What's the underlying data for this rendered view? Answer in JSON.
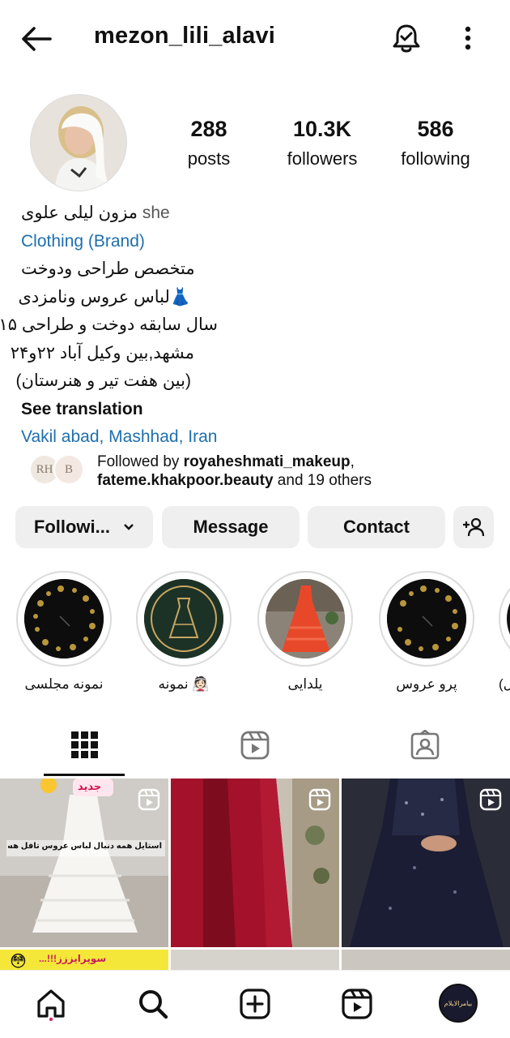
{
  "header": {
    "username": "mezon_lili_alavi",
    "back_icon": "arrow-left-icon",
    "bell_icon": "bell-icon",
    "more_icon": "more-vertical-icon"
  },
  "stats": {
    "posts_count": "288",
    "posts_label": "posts",
    "followers_count": "10.3K",
    "followers_label": "followers",
    "following_count": "586",
    "following_label": "following"
  },
  "bio": {
    "pronoun": "she",
    "name": "مزون لیلی علوی",
    "category": "Clothing (Brand)",
    "lines": [
      "متخصص طراحی ودوخت",
      "👗لباس عروس ونامزدی",
      "سال سابقه دوخت و طراحی ۱۵",
      "مشهد,بین وکیل آباد ۲۲و۲۴",
      "(بین هفت تیر و هنرستان)"
    ],
    "see_translation": "See translation",
    "location": "Vakil abad, Mashhad, Iran"
  },
  "followed_by": {
    "prefix": "Followed by ",
    "user1": "royaheshmati_makeup",
    "separator": ",",
    "user2": "fateme.khakpoor.beauty",
    "suffix": " and 19 others",
    "avatar1_text": "RH",
    "avatar2_text": "B"
  },
  "actions": {
    "following_label": "Followi...",
    "message_label": "Message",
    "contact_label": "Contact",
    "add_user_icon": "add-user-icon"
  },
  "highlights": [
    {
      "label": "نمونه مجلسی"
    },
    {
      "label": "نمونه 👰🏻"
    },
    {
      "label": "یلدایی"
    },
    {
      "label": "پرو عروس"
    },
    {
      "label": "(ل"
    }
  ],
  "tabs": {
    "grid_icon": "grid-icon",
    "reels_icon": "reels-icon",
    "tagged_icon": "tagged-icon"
  },
  "grid": {
    "post1_overlay_top": "جدید",
    "post1_caption": "استایل همه دنبال لباس عروس تافل هستن!",
    "post4_caption": "سوپرایززز!!!..."
  },
  "bottom_nav": {
    "home_icon": "home-icon",
    "search_icon": "search-icon",
    "create_icon": "plus-square-icon",
    "reels_icon": "reels-icon",
    "profile_label": "بیامرالایلام"
  },
  "colors": {
    "link_blue": "#1e6fad",
    "button_bg": "#efefef"
  }
}
